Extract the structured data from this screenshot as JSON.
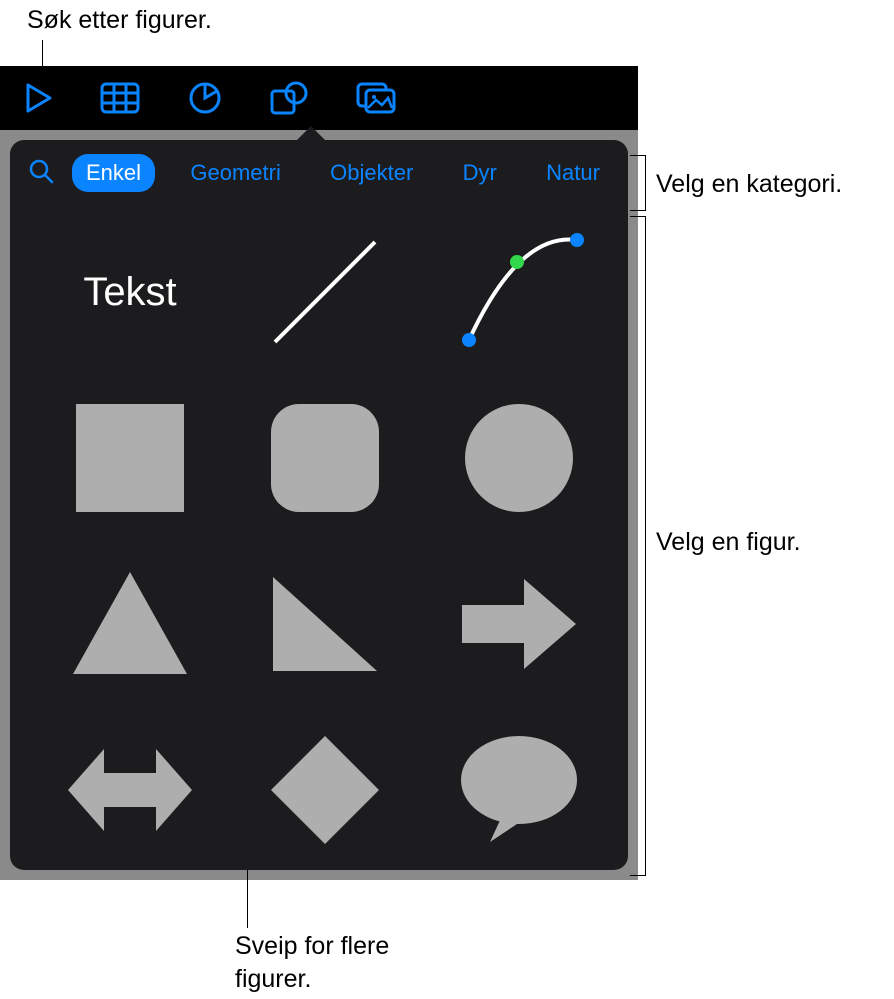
{
  "callouts": {
    "search": "Søk etter figurer.",
    "category": "Velg en kategori.",
    "shape": "Velg en figur.",
    "swipe": "Sveip for flere\nfigurer."
  },
  "categories": [
    {
      "label": "Enkel",
      "active": true
    },
    {
      "label": "Geometri",
      "active": false
    },
    {
      "label": "Objekter",
      "active": false
    },
    {
      "label": "Dyr",
      "active": false
    },
    {
      "label": "Natur",
      "active": false
    }
  ],
  "shapes": {
    "text_label": "Tekst"
  },
  "colors": {
    "accent": "#0a84ff",
    "shape_fill": "#aeaeae",
    "popover_bg": "#1c1c1e"
  }
}
